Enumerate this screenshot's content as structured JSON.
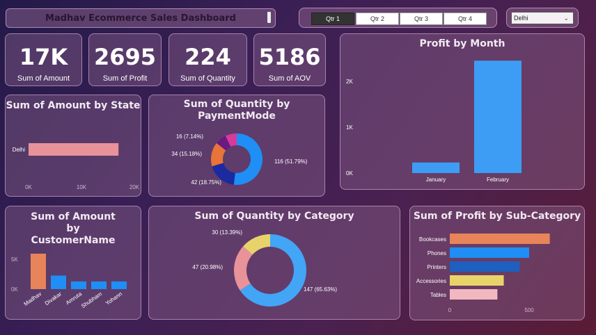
{
  "header": {
    "title": "Madhav Ecommerce Sales Dashboard"
  },
  "quarters": {
    "q1": "Qtr 1",
    "q2": "Qtr 2",
    "q3": "Qtr 3",
    "q4": "Qtr 4",
    "selected": "Qtr 1"
  },
  "state_filter": {
    "value": "Delhi"
  },
  "kpis": {
    "amount": {
      "value": "17K",
      "label": "Sum of Amount"
    },
    "profit": {
      "value": "2695",
      "label": "Sum of Profit"
    },
    "quantity": {
      "value": "224",
      "label": "Sum of Quantity"
    },
    "aov": {
      "value": "5186",
      "label": "Sum of AOV"
    }
  },
  "colors": {
    "blue": "#3d9df5",
    "pink": "#e8929a",
    "orange": "#e8845a",
    "navy": "#1b2aa0",
    "yellow": "#e8d36a",
    "lightpink": "#f2b8c0"
  },
  "chart_data": [
    {
      "id": "amount_by_state",
      "type": "bar",
      "orientation": "horizontal",
      "title": "Sum of Amount by State",
      "categories": [
        "Delhi"
      ],
      "values": [
        17000
      ],
      "xlim": [
        0,
        20000
      ],
      "xticks": [
        "0K",
        "10K",
        "20K"
      ],
      "color": "#e8929a"
    },
    {
      "id": "quantity_by_paymentmode",
      "type": "pie",
      "donut": true,
      "title": "Sum of Quantity by PaymentMode",
      "values": [
        116,
        42,
        34,
        16,
        16
      ],
      "labels": [
        "116 (51.79%)",
        "42 (18.75%)",
        "34 (15.18%)",
        "16 (7.14%)",
        ""
      ],
      "colors": [
        "#1f8ef5",
        "#1b2aa0",
        "#e8743a",
        "#6a1a80",
        "#d63a9a"
      ]
    },
    {
      "id": "profit_by_month",
      "type": "bar",
      "title": "Profit by Month",
      "categories": [
        "January",
        "February"
      ],
      "values": [
        230,
        2450
      ],
      "ylim": [
        0,
        2500
      ],
      "yticks": [
        "0K",
        "1K",
        "2K"
      ],
      "color": "#3d9df5"
    },
    {
      "id": "amount_by_customer",
      "type": "bar",
      "title": "Sum of Amount by CustomerName",
      "categories": [
        "Madhav",
        "Divakar",
        "Amruta",
        "Shubham",
        "Yohann"
      ],
      "values": [
        6000,
        2300,
        1300,
        1300,
        1300
      ],
      "ylim": [
        0,
        7000
      ],
      "yticks": [
        "0K",
        "5K"
      ],
      "colors": [
        "#e8845a",
        "#1f8ef5",
        "#1f8ef5",
        "#1f8ef5",
        "#1f8ef5"
      ]
    },
    {
      "id": "quantity_by_category",
      "type": "pie",
      "donut": true,
      "title": "Sum of Quantity by Category",
      "values": [
        147,
        47,
        30
      ],
      "labels": [
        "147 (65.63%)",
        "47 (20.98%)",
        "30 (13.39%)"
      ],
      "colors": [
        "#42a5f5",
        "#e8929a",
        "#e8d36a"
      ]
    },
    {
      "id": "profit_by_subcategory",
      "type": "bar",
      "orientation": "horizontal",
      "title": "Sum of Profit by Sub-Category",
      "categories": [
        "Bookcases",
        "Phones",
        "Printers",
        "Accessories",
        "Tables"
      ],
      "values": [
        630,
        500,
        440,
        340,
        300
      ],
      "xlim": [
        0,
        700
      ],
      "xticks": [
        "0",
        "500"
      ],
      "colors": [
        "#e8845a",
        "#1f8ef5",
        "#1e5fc0",
        "#e8d36a",
        "#f2b8c0"
      ]
    }
  ]
}
